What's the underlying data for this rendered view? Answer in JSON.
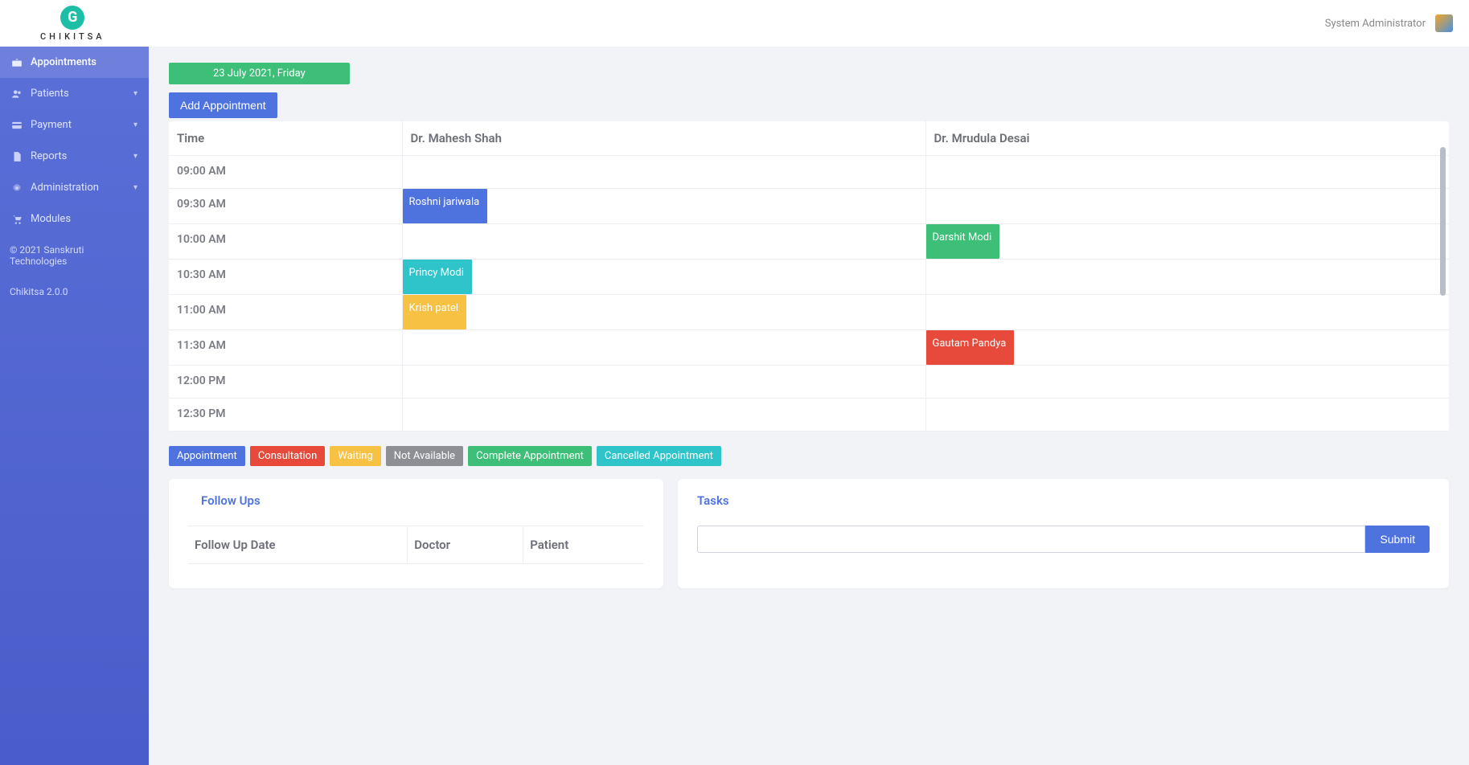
{
  "brand": {
    "name": "CHIKITSA",
    "mark": "G"
  },
  "topbar": {
    "user_label": "System Administrator"
  },
  "sidebar": {
    "items": [
      {
        "label": "Appointments",
        "icon": "briefcase",
        "active": true,
        "expandable": false
      },
      {
        "label": "Patients",
        "icon": "users",
        "active": false,
        "expandable": true
      },
      {
        "label": "Payment",
        "icon": "card",
        "active": false,
        "expandable": true
      },
      {
        "label": "Reports",
        "icon": "file",
        "active": false,
        "expandable": true
      },
      {
        "label": "Administration",
        "icon": "gear",
        "active": false,
        "expandable": true
      },
      {
        "label": "Modules",
        "icon": "cart",
        "active": false,
        "expandable": false
      }
    ],
    "copyright": "© 2021 Sanskruti Technologies",
    "version": "Chikitsa 2.0.0"
  },
  "schedule": {
    "date_label": "23 July 2021, Friday",
    "add_button": "Add Appointment",
    "columns": [
      "Time",
      "Dr. Mahesh Shah",
      "Dr. Mrudula Desai"
    ],
    "rows": [
      {
        "time": "09:00 AM",
        "c1": null,
        "c2": null
      },
      {
        "time": "09:30 AM",
        "c1": {
          "name": "Roshni jariwala",
          "status": "blue"
        },
        "c2": null
      },
      {
        "time": "10:00 AM",
        "c1": null,
        "c2": {
          "name": "Darshit Modi",
          "status": "green"
        }
      },
      {
        "time": "10:30 AM",
        "c1": {
          "name": "Princy Modi",
          "status": "teal"
        },
        "c2": null
      },
      {
        "time": "11:00 AM",
        "c1": {
          "name": "Krish patel",
          "status": "yellow"
        },
        "c2": null
      },
      {
        "time": "11:30 AM",
        "c1": null,
        "c2": {
          "name": "Gautam Pandya",
          "status": "red"
        }
      },
      {
        "time": "12:00 PM",
        "c1": null,
        "c2": null
      },
      {
        "time": "12:30 PM",
        "c1": null,
        "c2": null
      }
    ]
  },
  "legend": [
    {
      "label": "Appointment",
      "color": "blue"
    },
    {
      "label": "Consultation",
      "color": "red"
    },
    {
      "label": "Waiting",
      "color": "yellow"
    },
    {
      "label": "Not Available",
      "color": "grey"
    },
    {
      "label": "Complete Appointment",
      "color": "green"
    },
    {
      "label": "Cancelled Appointment",
      "color": "teal"
    }
  ],
  "followups": {
    "title": "Follow Ups",
    "columns": [
      "Follow Up Date",
      "Doctor",
      "Patient"
    ]
  },
  "tasks": {
    "title": "Tasks",
    "input_value": "",
    "submit_label": "Submit"
  }
}
